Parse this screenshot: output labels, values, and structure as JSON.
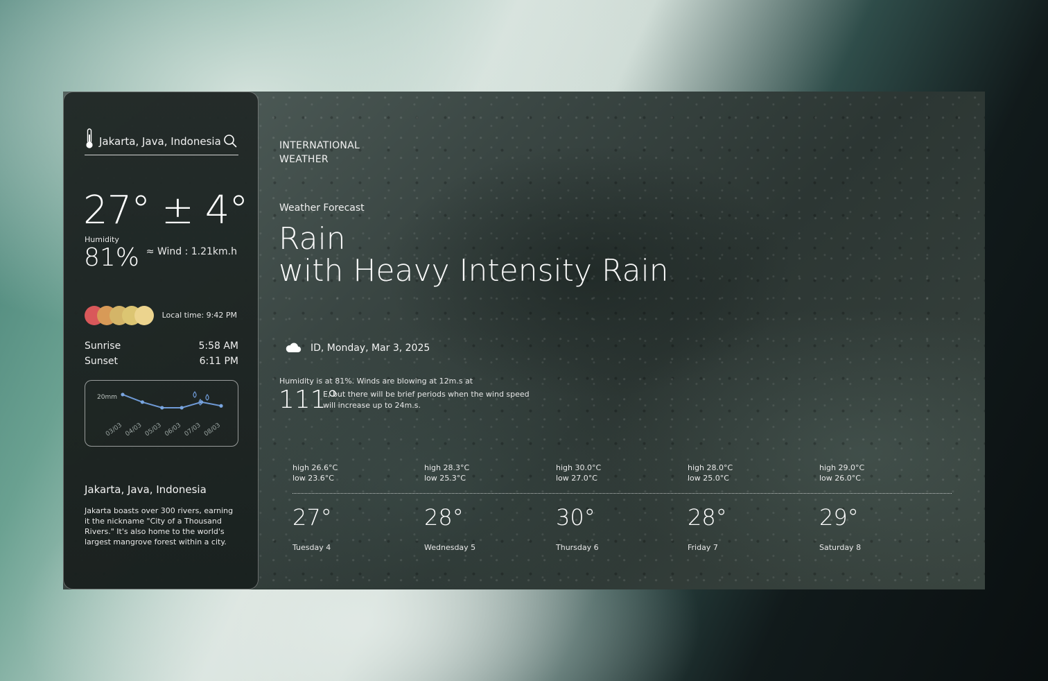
{
  "location": "Jakarta, Java, Indonesia",
  "current": {
    "temp_range": "27° ± 4°",
    "humidity_label": "Humidity",
    "humidity_value": "81%",
    "wind": "≈ Wind : 1.21km.h",
    "local_time": "Local time: 9:42 PM",
    "sunrise_label": "Sunrise",
    "sunrise_value": "5:58 AM",
    "sunset_label": "Sunset",
    "sunset_value": "6:11 PM"
  },
  "palette_dots": [
    "#d9585a",
    "#d89a57",
    "#d4b568",
    "#dcc572",
    "#ecd48e"
  ],
  "chart_data": {
    "type": "line",
    "ylabel": "20mm",
    "categories": [
      "03/03",
      "04/03",
      "05/03",
      "06/03",
      "07/03",
      "08/03"
    ],
    "values": [
      14,
      10,
      7,
      7,
      10,
      8
    ],
    "ylim": [
      0,
      20
    ],
    "grid": false
  },
  "about": {
    "title": "Jakarta, Java, Indonesia",
    "text": "Jakarta boasts over 300 rivers, earning it the nickname \"City of a Thousand Rivers.\" It's also home to the world's largest mangrove forest within a city."
  },
  "brand": {
    "line1": "INTERNATIONAL",
    "line2": "WEATHER"
  },
  "forecast": {
    "label": "Weather Forecast",
    "headline_1": "Rain",
    "headline_2": "with Heavy Intensity Rain",
    "date": "ID, Monday, Mar 3, 2025",
    "detail_1": "Humidity is at 81%. Winds are blowing at 12m.s at",
    "degrees": "111°",
    "detail_2": "E, but there will be brief periods when the wind speed will increase up to 24m.s."
  },
  "days": [
    {
      "high": "high 26.6°C",
      "low": "low 23.6°C",
      "temp": "27°",
      "name": "Tuesday 4"
    },
    {
      "high": "high 28.3°C",
      "low": "low 25.3°C",
      "temp": "28°",
      "name": "Wednesday 5"
    },
    {
      "high": "high 30.0°C",
      "low": "low 27.0°C",
      "temp": "30°",
      "name": "Thursday 6"
    },
    {
      "high": "high 28.0°C",
      "low": "low 25.0°C",
      "temp": "28°",
      "name": "Friday 7"
    },
    {
      "high": "high 29.0°C",
      "low": "low 26.0°C",
      "temp": "29°",
      "name": "Saturday 8"
    }
  ]
}
